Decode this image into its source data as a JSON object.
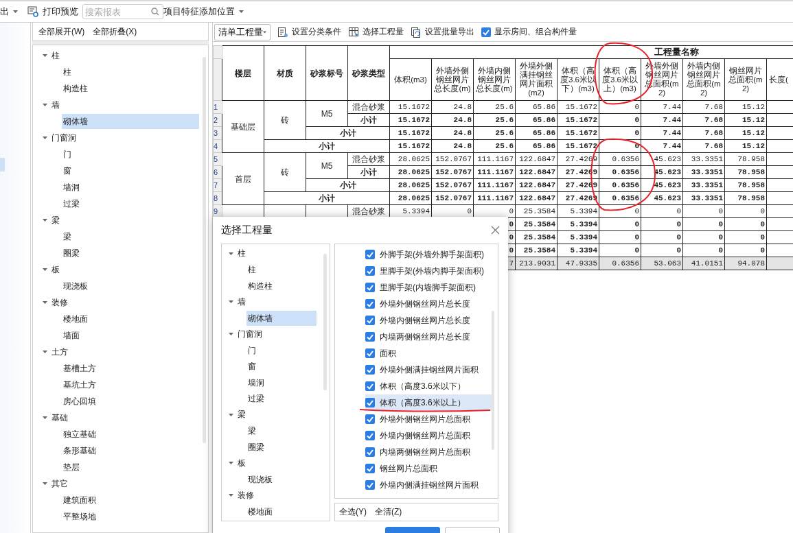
{
  "toolbar": {
    "export_menu": "出",
    "print_preview": "打印预览",
    "search": {
      "placeholder": "搜索报表"
    },
    "feature_position_menu": "项目特征添加位置"
  },
  "tree_panel": {
    "expand_all": "全部展开(W)",
    "collapse_all": "全部折叠(X)",
    "items": [
      {
        "label": "柱",
        "expanded": true,
        "selected": false,
        "children": [
          {
            "label": "柱",
            "selected": false
          },
          {
            "label": "构造柱",
            "selected": false
          }
        ]
      },
      {
        "label": "墙",
        "expanded": true,
        "selected": false,
        "children": [
          {
            "label": "砌体墙",
            "selected": true
          }
        ]
      },
      {
        "label": "门窗洞",
        "expanded": true,
        "selected": false,
        "children": [
          {
            "label": "门",
            "selected": false
          },
          {
            "label": "窗",
            "selected": false
          },
          {
            "label": "墙洞",
            "selected": false
          },
          {
            "label": "过梁",
            "selected": false
          }
        ]
      },
      {
        "label": "梁",
        "expanded": true,
        "selected": false,
        "children": [
          {
            "label": "梁",
            "selected": false
          },
          {
            "label": "圈梁",
            "selected": false
          }
        ]
      },
      {
        "label": "板",
        "expanded": true,
        "selected": false,
        "children": [
          {
            "label": "现浇板",
            "selected": false
          }
        ]
      },
      {
        "label": "装修",
        "expanded": true,
        "selected": false,
        "children": [
          {
            "label": "楼地面",
            "selected": false
          },
          {
            "label": "墙面",
            "selected": false
          }
        ]
      },
      {
        "label": "土方",
        "expanded": true,
        "selected": false,
        "children": [
          {
            "label": "基槽土方",
            "selected": false
          },
          {
            "label": "基坑土方",
            "selected": false
          },
          {
            "label": "房心回填",
            "selected": false
          }
        ]
      },
      {
        "label": "基础",
        "expanded": true,
        "selected": false,
        "children": [
          {
            "label": "独立基础",
            "selected": false
          },
          {
            "label": "条形基础",
            "selected": false
          },
          {
            "label": "垫层",
            "selected": false
          }
        ]
      },
      {
        "label": "其它",
        "expanded": true,
        "selected": false,
        "children": [
          {
            "label": "建筑面积",
            "selected": false
          },
          {
            "label": "平整场地",
            "selected": false
          }
        ]
      }
    ]
  },
  "report": {
    "toolbar": {
      "list_type": "清单工程量",
      "set_category": "设置分类条件",
      "choose_quantities": "选择工程量",
      "batch_export": "设置批量导出",
      "show_rooms": {
        "label": "显示房间、组合构件量",
        "checked": true
      }
    },
    "table": {
      "columns": [
        "楼层",
        "材质",
        "砂浆标号",
        "砂浆类型"
      ],
      "group_header": "工程量名称",
      "quantity_columns": [
        "体积(m3)",
        "外墙外侧钢丝网片总长度(m)",
        "外墙内侧钢丝网片总长度(m)",
        "外墙外侧满挂钢丝网片面积(m2)",
        "体积（高度3.6米以下）(m3)",
        "体积（高度3.6米以上）(m3)",
        "外墙外侧钢丝网片总面积(m2)",
        "外墙内侧钢丝网片总面积(m2)",
        "钢丝网片总面积(m2)",
        "长度("
      ],
      "rows": [
        {
          "num": "1",
          "kind": "item",
          "floor": "基础层",
          "material": "砖",
          "grade": "M5",
          "type": "混合砂浆",
          "values": [
            "15.1672",
            "24.8",
            "25.6",
            "65.86",
            "15.1672",
            "0",
            "7.44",
            "7.68",
            "15.12"
          ]
        },
        {
          "num": "2",
          "kind": "grade_subtotal",
          "label": "小计",
          "values": [
            "15.1672",
            "24.8",
            "25.6",
            "65.86",
            "15.1672",
            "0",
            "7.44",
            "7.68",
            "15.12"
          ]
        },
        {
          "num": "3",
          "kind": "material_subtotal",
          "label": "小计",
          "values": [
            "15.1672",
            "24.8",
            "25.6",
            "65.86",
            "15.1672",
            "0",
            "7.44",
            "7.68",
            "15.12"
          ]
        },
        {
          "num": "4",
          "kind": "floor_subtotal",
          "label": "小计",
          "values": [
            "15.1672",
            "24.8",
            "25.6",
            "65.86",
            "15.1672",
            "0",
            "7.44",
            "7.68",
            "15.12"
          ]
        },
        {
          "num": "5",
          "kind": "item",
          "floor": "首层",
          "material": "砖",
          "grade": "M5",
          "type": "混合砂浆",
          "values": [
            "28.0625",
            "152.0767",
            "111.1167",
            "122.6847",
            "27.4269",
            "0.6356",
            "45.623",
            "33.3351",
            "78.958"
          ]
        },
        {
          "num": "6",
          "kind": "grade_subtotal",
          "label": "小计",
          "values": [
            "28.0625",
            "152.0767",
            "111.1167",
            "122.6847",
            "27.4269",
            "0.6356",
            "45.623",
            "33.3351",
            "78.958"
          ]
        },
        {
          "num": "7",
          "kind": "material_subtotal",
          "label": "小计",
          "values": [
            "28.0625",
            "152.0767",
            "111.1167",
            "122.6847",
            "27.4269",
            "0.6356",
            "45.623",
            "33.3351",
            "78.958"
          ]
        },
        {
          "num": "8",
          "kind": "floor_subtotal",
          "label": "小计",
          "values": [
            "28.0625",
            "152.0767",
            "111.1167",
            "122.6847",
            "27.4269",
            "0.6356",
            "45.623",
            "33.3351",
            "78.958"
          ]
        },
        {
          "num": "9",
          "kind": "item",
          "type": "混合砂浆",
          "values": [
            "5.3394",
            "0",
            "0",
            "25.3584",
            "5.3394",
            "0",
            "0",
            "0",
            "0"
          ]
        },
        {
          "kind": "grade_subtotal",
          "values": [
            "0",
            "25.3584",
            "5.3394",
            "0",
            "0",
            "0",
            "0"
          ]
        },
        {
          "kind": "material_subtotal",
          "values": [
            "0",
            "25.3584",
            "5.3394",
            "0",
            "0",
            "0",
            "0"
          ]
        },
        {
          "kind": "floor_subtotal",
          "values": [
            "0",
            "25.3584",
            "5.3394",
            "0",
            "0",
            "0",
            "0"
          ]
        },
        {
          "kind": "total",
          "values": [
            "7",
            "213.9031",
            "47.9335",
            "0.6356",
            "53.063",
            "41.0151",
            "94.078"
          ]
        }
      ]
    }
  },
  "dialog": {
    "title": "选择工程量",
    "tree": [
      {
        "label": "柱",
        "expanded": true,
        "selected": false,
        "children": [
          {
            "label": "柱",
            "selected": false
          },
          {
            "label": "构造柱",
            "selected": false
          }
        ]
      },
      {
        "label": "墙",
        "expanded": true,
        "selected": false,
        "children": [
          {
            "label": "砌体墙",
            "selected": true
          }
        ]
      },
      {
        "label": "门窗洞",
        "expanded": true,
        "selected": false,
        "children": [
          {
            "label": "门",
            "selected": false
          },
          {
            "label": "窗",
            "selected": false
          },
          {
            "label": "墙洞",
            "selected": false
          },
          {
            "label": "过梁",
            "selected": false
          }
        ]
      },
      {
        "label": "梁",
        "expanded": true,
        "selected": false,
        "children": [
          {
            "label": "梁",
            "selected": false
          },
          {
            "label": "圈梁",
            "selected": false
          }
        ]
      },
      {
        "label": "板",
        "expanded": true,
        "selected": false,
        "children": [
          {
            "label": "现浇板",
            "selected": false
          }
        ]
      },
      {
        "label": "装修",
        "expanded": true,
        "selected": false,
        "children": [
          {
            "label": "楼地面",
            "selected": false
          }
        ]
      }
    ],
    "quantities": [
      {
        "label": "外脚手架(外墙外脚手架面积)",
        "checked": true,
        "selected": false
      },
      {
        "label": "里脚手架(外墙内脚手架面积)",
        "checked": true,
        "selected": false
      },
      {
        "label": "里脚手架(内墙脚手架面积)",
        "checked": true,
        "selected": false
      },
      {
        "label": "外墙外侧钢丝网片总长度",
        "checked": true,
        "selected": false
      },
      {
        "label": "外墙内侧钢丝网片总长度",
        "checked": true,
        "selected": false
      },
      {
        "label": "内墙两侧钢丝网片总长度",
        "checked": true,
        "selected": false
      },
      {
        "label": "面积",
        "checked": true,
        "selected": false
      },
      {
        "label": "外墙外侧满挂钢丝网片面积",
        "checked": true,
        "selected": false
      },
      {
        "label": "体积（高度3.6米以下）",
        "checked": true,
        "selected": false
      },
      {
        "label": "体积（高度3.6米以上）",
        "checked": true,
        "selected": true
      },
      {
        "label": "外墙外侧钢丝网片总面积",
        "checked": true,
        "selected": false
      },
      {
        "label": "外墙内侧钢丝网片总面积",
        "checked": true,
        "selected": false
      },
      {
        "label": "内墙两侧钢丝网片总面积",
        "checked": true,
        "selected": false
      },
      {
        "label": "钢丝网片总面积",
        "checked": true,
        "selected": false
      },
      {
        "label": "外墙内侧满挂钢丝网片面积",
        "checked": true,
        "selected": false
      }
    ],
    "select_all": "全选(Y)",
    "clear_all": "全清(Z)",
    "buttons": [
      {
        "kind": "primary"
      },
      {
        "kind": "secondary"
      }
    ]
  },
  "annotations": [
    {
      "kind": "circle"
    },
    {
      "kind": "circle"
    },
    {
      "kind": "underline"
    }
  ]
}
